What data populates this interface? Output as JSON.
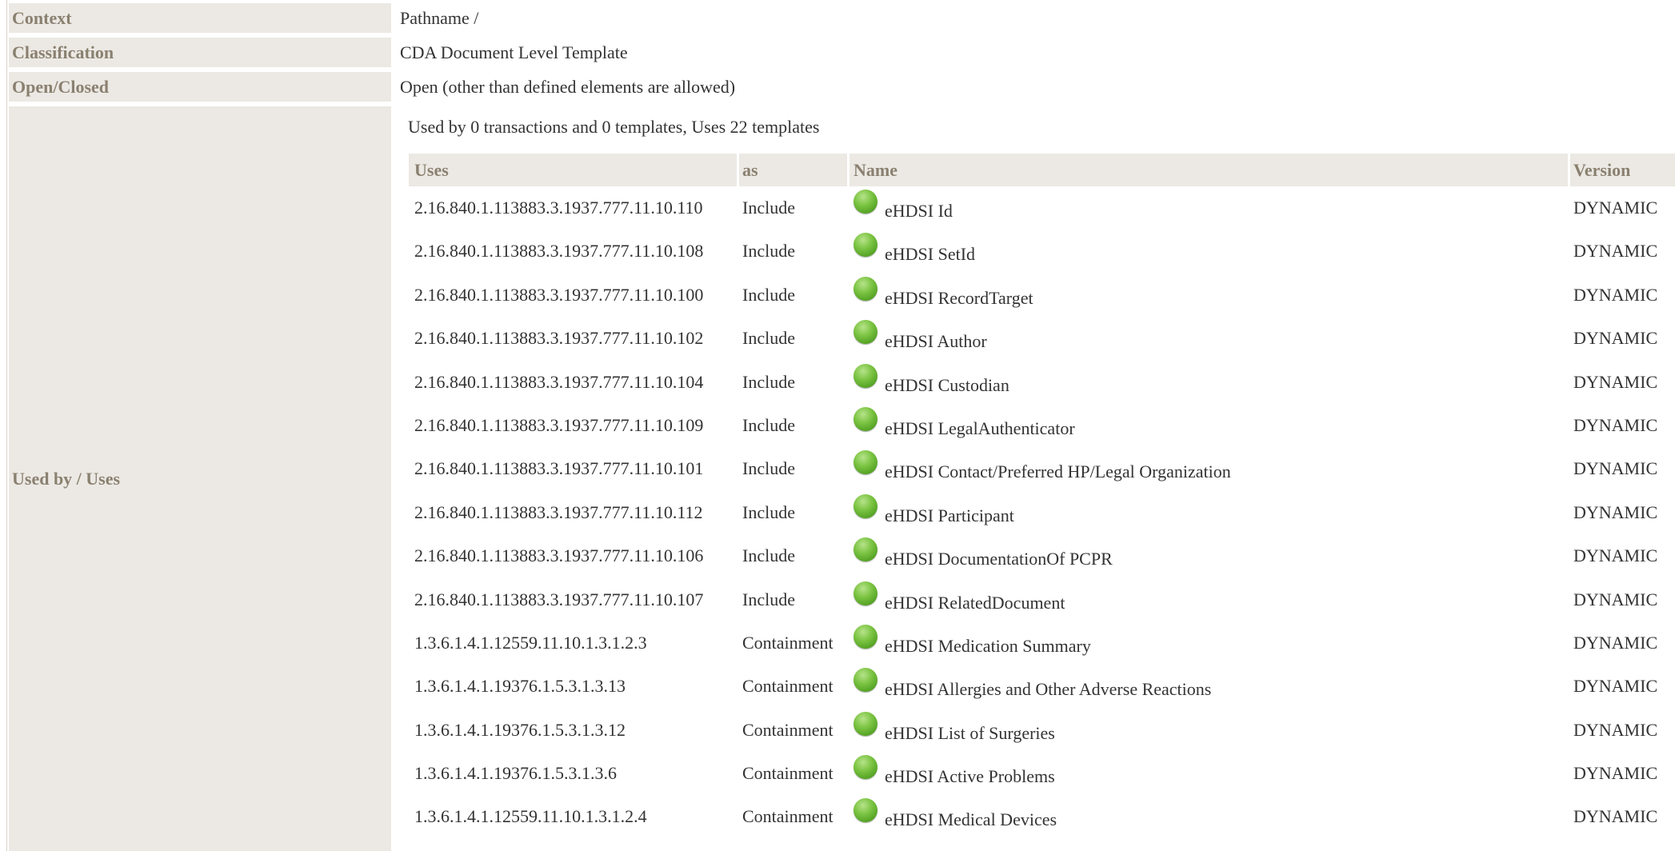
{
  "properties": [
    {
      "label": "Context",
      "value": "Pathname /"
    },
    {
      "label": "Classification",
      "value": "CDA Document Level Template"
    },
    {
      "label": "Open/Closed",
      "value": "Open (other than defined elements are allowed)"
    },
    {
      "label": "Used by / Uses"
    }
  ],
  "usage": {
    "summary": "Used by 0 transactions and 0 templates, Uses 22 templates",
    "columns": [
      "Uses",
      "as",
      "Name",
      "Version"
    ],
    "status_icon": "status-active-green-dot-icon",
    "rows": [
      {
        "uses": "2.16.840.1.113883.3.1937.777.11.10.110",
        "as": "Include",
        "name": "eHDSI Id",
        "version": "DYNAMIC"
      },
      {
        "uses": "2.16.840.1.113883.3.1937.777.11.10.108",
        "as": "Include",
        "name": "eHDSI SetId",
        "version": "DYNAMIC"
      },
      {
        "uses": "2.16.840.1.113883.3.1937.777.11.10.100",
        "as": "Include",
        "name": "eHDSI RecordTarget",
        "version": "DYNAMIC"
      },
      {
        "uses": "2.16.840.1.113883.3.1937.777.11.10.102",
        "as": "Include",
        "name": "eHDSI Author",
        "version": "DYNAMIC"
      },
      {
        "uses": "2.16.840.1.113883.3.1937.777.11.10.104",
        "as": "Include",
        "name": "eHDSI Custodian",
        "version": "DYNAMIC"
      },
      {
        "uses": "2.16.840.1.113883.3.1937.777.11.10.109",
        "as": "Include",
        "name": "eHDSI LegalAuthenticator",
        "version": "DYNAMIC"
      },
      {
        "uses": "2.16.840.1.113883.3.1937.777.11.10.101",
        "as": "Include",
        "name": "eHDSI Contact/Preferred HP/Legal Organization",
        "version": "DYNAMIC"
      },
      {
        "uses": "2.16.840.1.113883.3.1937.777.11.10.112",
        "as": "Include",
        "name": "eHDSI Participant",
        "version": "DYNAMIC"
      },
      {
        "uses": "2.16.840.1.113883.3.1937.777.11.10.106",
        "as": "Include",
        "name": "eHDSI DocumentationOf PCPR",
        "version": "DYNAMIC"
      },
      {
        "uses": "2.16.840.1.113883.3.1937.777.11.10.107",
        "as": "Include",
        "name": "eHDSI RelatedDocument",
        "version": "DYNAMIC"
      },
      {
        "uses": "1.3.6.1.4.1.12559.11.10.1.3.1.2.3",
        "as": "Containment",
        "name": "eHDSI Medication Summary",
        "version": "DYNAMIC"
      },
      {
        "uses": "1.3.6.1.4.1.19376.1.5.3.1.3.13",
        "as": "Containment",
        "name": "eHDSI Allergies and Other Adverse Reactions",
        "version": "DYNAMIC"
      },
      {
        "uses": "1.3.6.1.4.1.19376.1.5.3.1.3.12",
        "as": "Containment",
        "name": "eHDSI List of Surgeries",
        "version": "DYNAMIC"
      },
      {
        "uses": "1.3.6.1.4.1.19376.1.5.3.1.3.6",
        "as": "Containment",
        "name": "eHDSI Active Problems",
        "version": "DYNAMIC"
      },
      {
        "uses": "1.3.6.1.4.1.12559.11.10.1.3.1.2.4",
        "as": "Containment",
        "name": "eHDSI Medical Devices",
        "version": "DYNAMIC"
      }
    ]
  },
  "colors": {
    "label_background": "#ece9e4",
    "label_text": "#8a8070",
    "body_text": "#333333",
    "status_green": "#6cbf38"
  }
}
